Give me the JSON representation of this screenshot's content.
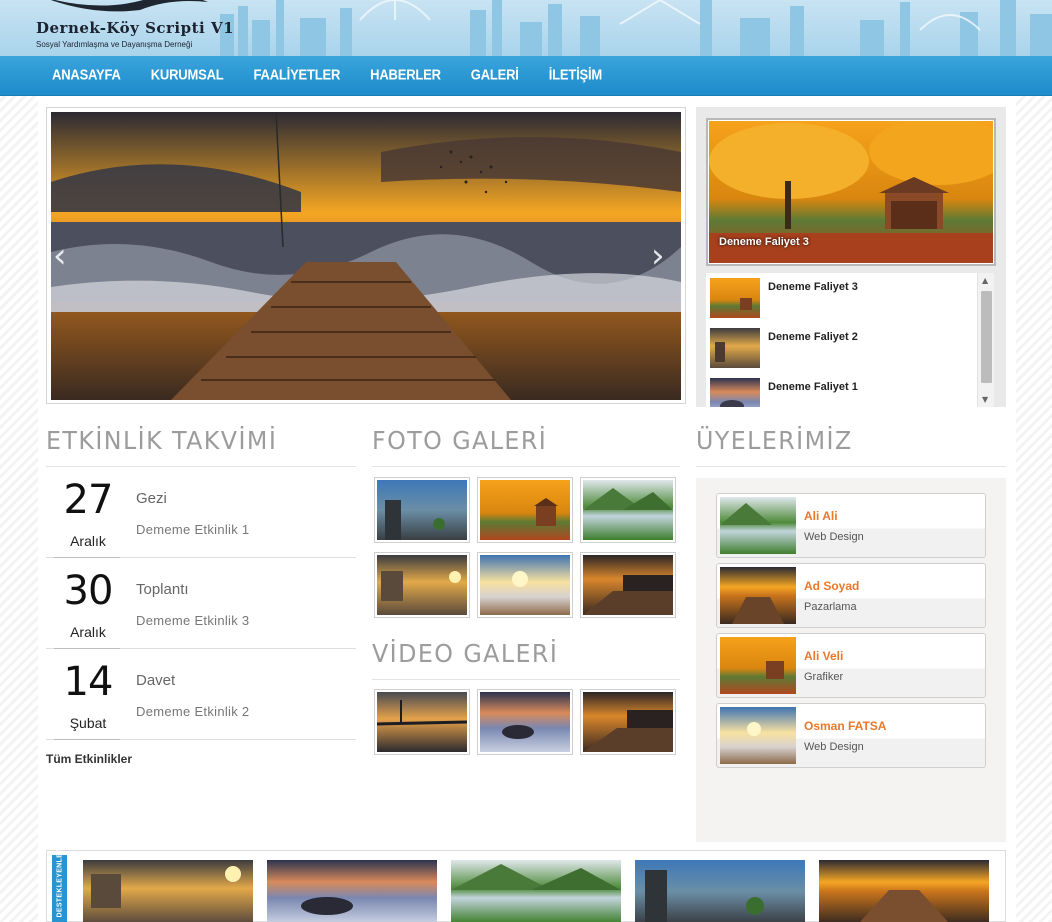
{
  "header": {
    "logo_title": "Dernek-Köy Scripti V1",
    "logo_subtitle": "Sosyal Yardımlaşma ve Dayanışma Derneği"
  },
  "nav": {
    "items": [
      "ANASAYFA",
      "KURUMSAL",
      "FAALİYETLER",
      "HABERLER",
      "GALERİ",
      "İLETİŞİM"
    ]
  },
  "slider": {
    "prev_label": "‹",
    "next_label": "›",
    "prev_icon": "chevron-left-icon",
    "next_icon": "chevron-right-icon"
  },
  "activities": {
    "featured_caption": "Deneme Faliyet 3",
    "items": [
      "Deneme Faliyet 3",
      "Deneme Faliyet 2",
      "Deneme Faliyet 1"
    ],
    "scroll_up": "▲",
    "scroll_down": "▼"
  },
  "events": {
    "title": "ETKİNLİK TAKVİMİ",
    "items": [
      {
        "day": "27",
        "month": "Aralık",
        "title": "Gezi",
        "desc": "Dememe Etkinlik 1"
      },
      {
        "day": "30",
        "month": "Aralık",
        "title": "Toplantı",
        "desc": "Dememe Etkinlik 3"
      },
      {
        "day": "14",
        "month": "Şubat",
        "title": "Davet",
        "desc": "Dememe Etkinlik 2"
      }
    ],
    "all_link": "Tüm Etkinlikler"
  },
  "photo_gallery": {
    "title": "FOTO GALERİ"
  },
  "video_gallery": {
    "title": "VİDEO GALERİ"
  },
  "members": {
    "title": "ÜYELERİMİZ",
    "items": [
      {
        "name": "Ali Ali",
        "role": "Web Design"
      },
      {
        "name": "Ad Soyad",
        "role": "Pazarlama"
      },
      {
        "name": "Ali Veli",
        "role": "Grafiker"
      },
      {
        "name": "Osman FATSA",
        "role": "Web Design"
      }
    ]
  },
  "sponsors": {
    "label": "DESTEKLEYENLER"
  },
  "colors": {
    "nav_blue": "#1d8ccc",
    "header_sky": "#a9d4ec",
    "accent_orange": "#e8792b",
    "heading_gray": "#9c9c9c"
  }
}
